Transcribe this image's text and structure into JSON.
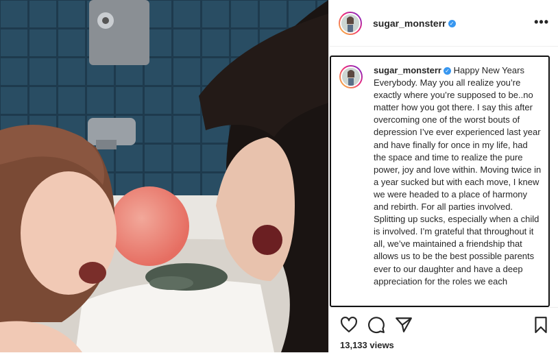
{
  "post": {
    "username": "sugar_monsterr",
    "verified_icon": "verified-badge-icon",
    "more_label": "•••",
    "caption": "Happy New Years Everybody. May you all realize you’re exactly where you’re supposed to be..no matter how you got there. I say this after overcoming one of the worst bouts of depression I’ve ever experienced last year and have finally for once in my life, had the space and time to realize the pure power, joy and love within. Moving twice in a year sucked but with each move, I knew we were headed to a place of harmony and rebirth. For all parties involved. Splitting up sucks, especially when a child is involved. I’m grateful that throughout it all, we’ve maintained a friendship that allows us to be the best possible parents ever to our daughter and have a deep appreciation for the roles we each",
    "views": "13,133 views"
  },
  "icons": {
    "like": "heart-icon",
    "comment": "comment-icon",
    "share": "share-icon",
    "save": "bookmark-icon"
  },
  "colors": {
    "verified": "#3897f0",
    "text": "#262626",
    "border": "#efefef"
  }
}
